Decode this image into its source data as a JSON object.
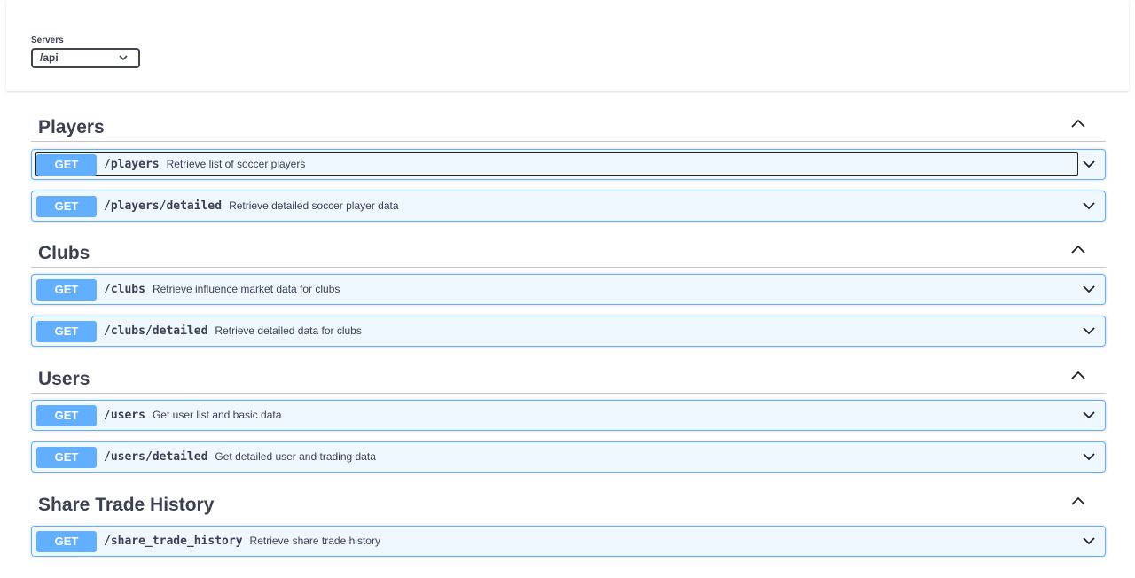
{
  "servers": {
    "label": "Servers",
    "selected": "/api"
  },
  "method_color": "#61affe",
  "sections": [
    {
      "title": "Players",
      "operations": [
        {
          "method": "GET",
          "path": "/players",
          "summary": "Retrieve list of soccer players"
        },
        {
          "method": "GET",
          "path": "/players/detailed",
          "summary": "Retrieve detailed soccer player data"
        }
      ]
    },
    {
      "title": "Clubs",
      "operations": [
        {
          "method": "GET",
          "path": "/clubs",
          "summary": "Retrieve influence market data for clubs"
        },
        {
          "method": "GET",
          "path": "/clubs/detailed",
          "summary": "Retrieve detailed data for clubs"
        }
      ]
    },
    {
      "title": "Users",
      "operations": [
        {
          "method": "GET",
          "path": "/users",
          "summary": "Get user list and basic data"
        },
        {
          "method": "GET",
          "path": "/users/detailed",
          "summary": "Get detailed user and trading data"
        }
      ]
    },
    {
      "title": "Share Trade History",
      "operations": [
        {
          "method": "GET",
          "path": "/share_trade_history",
          "summary": "Retrieve share trade history"
        }
      ]
    }
  ]
}
